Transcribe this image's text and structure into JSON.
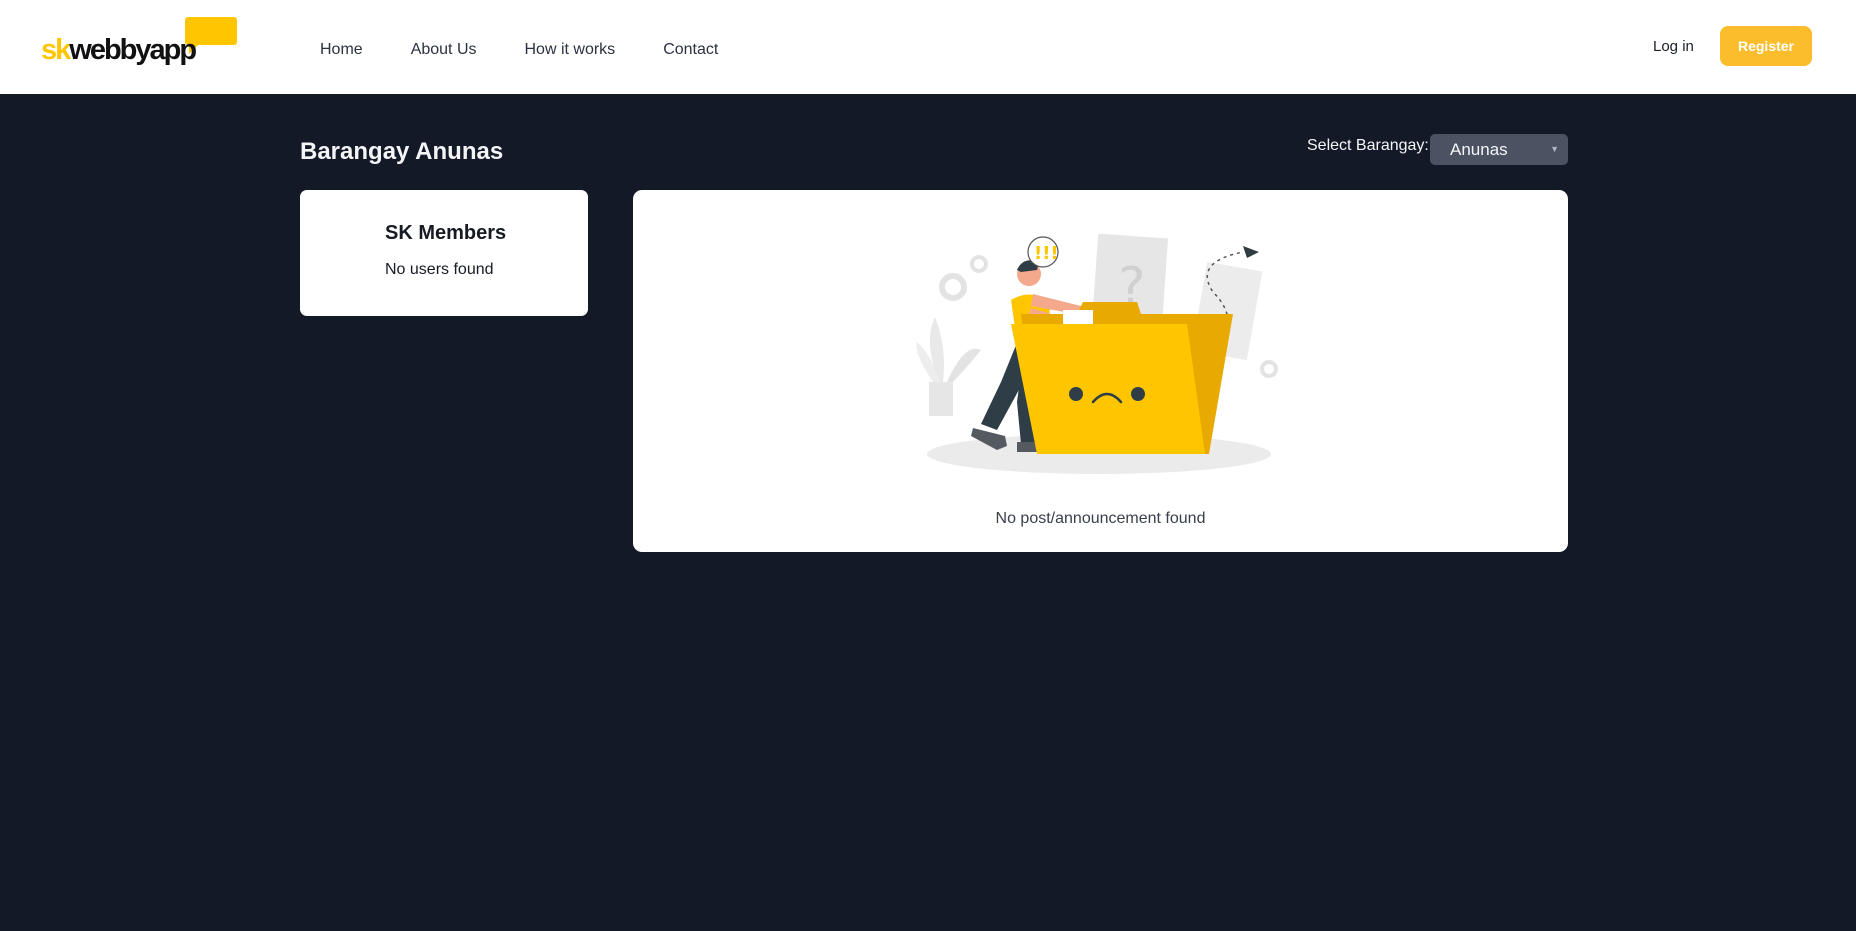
{
  "header": {
    "logo": {
      "part1": "sk",
      "part2": "webbyapp"
    },
    "nav": [
      "Home",
      "About Us",
      "How it works",
      "Contact"
    ],
    "login_label": "Log in",
    "register_label": "Register"
  },
  "page": {
    "title": "Barangay Anunas",
    "select_label": "Select Barangay:",
    "select_value": "Anunas"
  },
  "members": {
    "title": "SK Members",
    "empty_text": "No users found"
  },
  "posts": {
    "empty_text": "No post/announcement found",
    "illustration_bubble": "!!!"
  },
  "colors": {
    "accent": "#fbbd2b",
    "brand_yellow": "#ffc600",
    "background": "#131927"
  },
  "icons": {
    "logo": "speech-bubble-logo",
    "illustration": "empty-folder-illustration",
    "select_caret": "chevron-down-icon"
  }
}
